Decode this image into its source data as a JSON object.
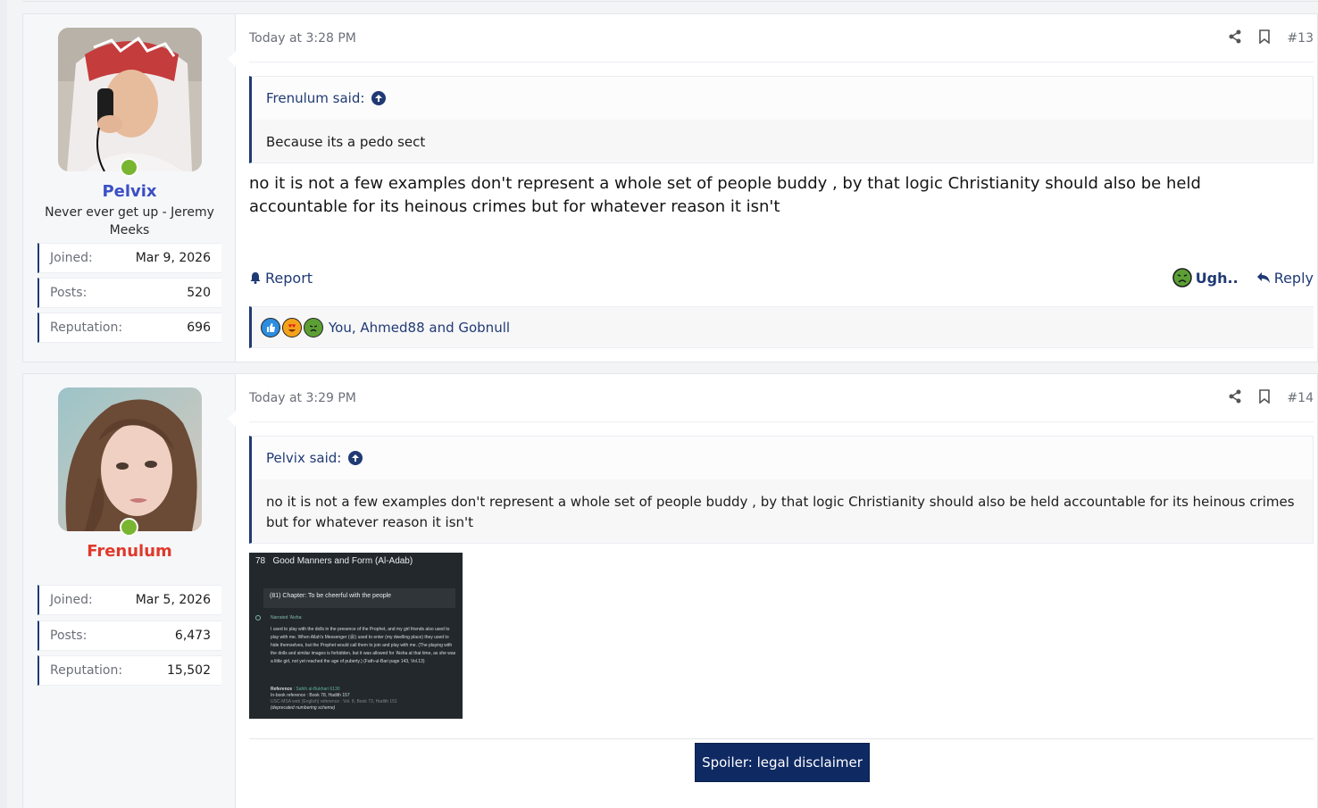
{
  "posts": [
    {
      "author": "Pelvix",
      "author_color": "#3b4fc4",
      "user_title": "Never ever get up - Jeremy Meeks",
      "stats": [
        {
          "label": "Joined:",
          "value": "Mar 9, 2026"
        },
        {
          "label": "Posts:",
          "value": "520"
        },
        {
          "label": "Reputation:",
          "value": "696"
        }
      ],
      "date": "Today at 3:28 PM",
      "post_number": "#13",
      "quote_author": "Frenulum said:",
      "quote_text": "Because its a pedo sect",
      "body": "no it is not a few examples don't represent a whole set of people buddy , by that logic Christianity should also be held accountable for its heinous crimes but for whatever reason it isn't",
      "report_label": "Report",
      "reaction_label": "Ugh..",
      "reply_label": "Reply",
      "reactions_text": "You, Ahmed88 and Gobnull",
      "reaction_icons": [
        "like-icon",
        "love-icon",
        "sick-icon"
      ]
    },
    {
      "author": "Frenulum",
      "author_color": "#e0392b",
      "stats": [
        {
          "label": "Joined:",
          "value": "Mar 5, 2026"
        },
        {
          "label": "Posts:",
          "value": "6,473"
        },
        {
          "label": "Reputation:",
          "value": "15,502"
        }
      ],
      "date": "Today at 3:29 PM",
      "post_number": "#14",
      "quote_author": "Pelvix said:",
      "quote_text": "no it is not a few examples don't represent a whole set of people buddy , by that logic Christianity should also be held accountable for its heinous crimes but for whatever reason it isn't",
      "attachment": {
        "chapter_no": "78",
        "book_title": "Good Manners and Form (Al-Adab)",
        "chapter": "(81)  Chapter: To be cheerful with the people",
        "narrator": "Narrated 'Aisha:",
        "text": "I used to play with the dolls in the presence of the Prophet, and my girl friends also used to play with me. When Allah's Messenger (ﷺ) used to enter (my dwelling place) they used to hide themselves, but the Prophet would call them to join and play with me. (The playing with the dolls and similar images is forbidden, but it was allowed for 'Aisha at that time, as she was a little girl, not yet reached the age of puberty.) (Fath-ul-Bari page 143, Vol.13)",
        "ref_label": "Reference",
        "ref_value": ": Sahih al-Bukhari 6130",
        "inbook_label": "In-book reference",
        "inbook_value": ": Book 78, Hadith 157",
        "usc_label": "USC-MSA web (English) reference",
        "usc_value": ": Vol. 8, Book 73, Hadith 151",
        "deprecated": "(deprecated numbering scheme)"
      },
      "spoiler_label": "Spoiler: legal disclaimer"
    }
  ]
}
